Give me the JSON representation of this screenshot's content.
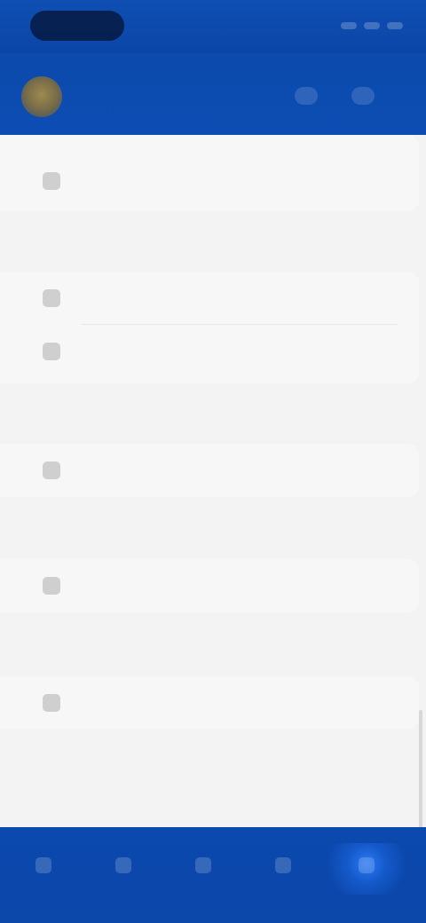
{
  "status": {
    "time": "",
    "indicators": [
      "signal-icon",
      "wifi-icon",
      "battery-icon"
    ]
  },
  "header": {
    "title": "",
    "subtitle": "",
    "actions": [
      "settings-icon",
      "notification-icon"
    ]
  },
  "sections": [
    {
      "label": "",
      "rows": [
        {
          "label": "",
          "icon": "settings-icon"
        }
      ]
    },
    {
      "label": "",
      "rows": [
        {
          "label": "",
          "icon": "document-icon"
        },
        {
          "label": "",
          "icon": "folder-icon"
        }
      ]
    },
    {
      "label": "",
      "rows": [
        {
          "label": "",
          "icon": "lock-icon"
        }
      ]
    },
    {
      "label": "",
      "rows": [
        {
          "label": "",
          "icon": "info-icon"
        }
      ]
    },
    {
      "label": "",
      "rows": [
        {
          "label": "",
          "icon": "help-icon"
        }
      ]
    }
  ],
  "logout": {
    "label": ""
  },
  "bottom_nav": [
    {
      "label": "",
      "icon": "home-icon"
    },
    {
      "label": "",
      "icon": "list-icon"
    },
    {
      "label": "",
      "icon": "calendar-icon"
    },
    {
      "label": "",
      "icon": "message-icon"
    },
    {
      "label": "",
      "icon": "person-icon"
    }
  ]
}
